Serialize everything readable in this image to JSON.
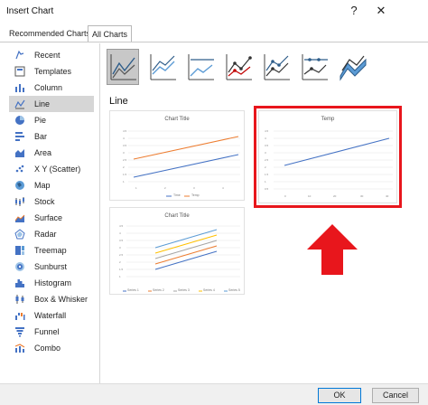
{
  "window": {
    "title": "Insert Chart",
    "help": "?",
    "close": "✕"
  },
  "tabs": [
    {
      "label": "Recommended Charts"
    },
    {
      "label": "All Charts"
    }
  ],
  "sidebar": {
    "items": [
      {
        "label": "Recent",
        "icon": "recent-icon"
      },
      {
        "label": "Templates",
        "icon": "templates-icon"
      },
      {
        "label": "Column",
        "icon": "column-icon"
      },
      {
        "label": "Line",
        "icon": "line-icon"
      },
      {
        "label": "Pie",
        "icon": "pie-icon"
      },
      {
        "label": "Bar",
        "icon": "bar-icon"
      },
      {
        "label": "Area",
        "icon": "area-icon"
      },
      {
        "label": "X Y (Scatter)",
        "icon": "scatter-icon"
      },
      {
        "label": "Map",
        "icon": "map-icon"
      },
      {
        "label": "Stock",
        "icon": "stock-icon"
      },
      {
        "label": "Surface",
        "icon": "surface-icon"
      },
      {
        "label": "Radar",
        "icon": "radar-icon"
      },
      {
        "label": "Treemap",
        "icon": "treemap-icon"
      },
      {
        "label": "Sunburst",
        "icon": "sunburst-icon"
      },
      {
        "label": "Histogram",
        "icon": "histogram-icon"
      },
      {
        "label": "Box & Whisker",
        "icon": "box-whisker-icon"
      },
      {
        "label": "Waterfall",
        "icon": "waterfall-icon"
      },
      {
        "label": "Funnel",
        "icon": "funnel-icon"
      },
      {
        "label": "Combo",
        "icon": "combo-icon"
      }
    ],
    "selected": "Line"
  },
  "main": {
    "section_title": "Line",
    "previews": [
      {
        "title": "Chart Title",
        "legend": [
          "Time",
          "Temp"
        ]
      },
      {
        "title": "Temp"
      },
      {
        "title": "Chart Title",
        "legend": [
          "Series 1",
          "Series 2",
          "Series 3",
          "Series 4",
          "Series 5"
        ]
      }
    ]
  },
  "colors": {
    "highlight": "#e8161c",
    "accent_blue": "#4472c4",
    "accent_orange": "#ed7d31"
  },
  "footer": {
    "ok": "OK",
    "cancel": "Cancel"
  }
}
